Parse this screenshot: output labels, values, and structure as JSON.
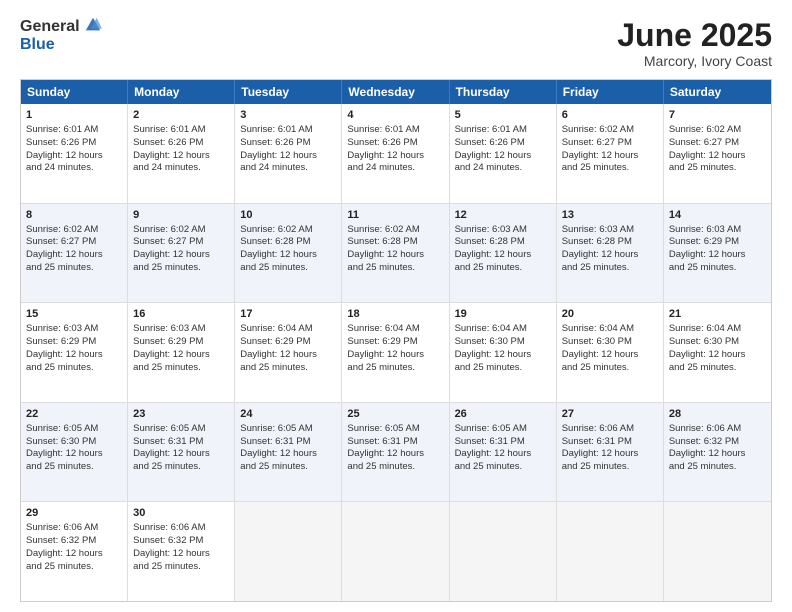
{
  "logo": {
    "general": "General",
    "blue": "Blue"
  },
  "title": "June 2025",
  "subtitle": "Marcory, Ivory Coast",
  "days": [
    "Sunday",
    "Monday",
    "Tuesday",
    "Wednesday",
    "Thursday",
    "Friday",
    "Saturday"
  ],
  "rows": [
    [
      {
        "num": "1",
        "lines": [
          "Sunrise: 6:01 AM",
          "Sunset: 6:26 PM",
          "Daylight: 12 hours",
          "and 24 minutes."
        ]
      },
      {
        "num": "2",
        "lines": [
          "Sunrise: 6:01 AM",
          "Sunset: 6:26 PM",
          "Daylight: 12 hours",
          "and 24 minutes."
        ]
      },
      {
        "num": "3",
        "lines": [
          "Sunrise: 6:01 AM",
          "Sunset: 6:26 PM",
          "Daylight: 12 hours",
          "and 24 minutes."
        ]
      },
      {
        "num": "4",
        "lines": [
          "Sunrise: 6:01 AM",
          "Sunset: 6:26 PM",
          "Daylight: 12 hours",
          "and 24 minutes."
        ]
      },
      {
        "num": "5",
        "lines": [
          "Sunrise: 6:01 AM",
          "Sunset: 6:26 PM",
          "Daylight: 12 hours",
          "and 24 minutes."
        ]
      },
      {
        "num": "6",
        "lines": [
          "Sunrise: 6:02 AM",
          "Sunset: 6:27 PM",
          "Daylight: 12 hours",
          "and 25 minutes."
        ]
      },
      {
        "num": "7",
        "lines": [
          "Sunrise: 6:02 AM",
          "Sunset: 6:27 PM",
          "Daylight: 12 hours",
          "and 25 minutes."
        ]
      }
    ],
    [
      {
        "num": "8",
        "lines": [
          "Sunrise: 6:02 AM",
          "Sunset: 6:27 PM",
          "Daylight: 12 hours",
          "and 25 minutes."
        ]
      },
      {
        "num": "9",
        "lines": [
          "Sunrise: 6:02 AM",
          "Sunset: 6:27 PM",
          "Daylight: 12 hours",
          "and 25 minutes."
        ]
      },
      {
        "num": "10",
        "lines": [
          "Sunrise: 6:02 AM",
          "Sunset: 6:28 PM",
          "Daylight: 12 hours",
          "and 25 minutes."
        ]
      },
      {
        "num": "11",
        "lines": [
          "Sunrise: 6:02 AM",
          "Sunset: 6:28 PM",
          "Daylight: 12 hours",
          "and 25 minutes."
        ]
      },
      {
        "num": "12",
        "lines": [
          "Sunrise: 6:03 AM",
          "Sunset: 6:28 PM",
          "Daylight: 12 hours",
          "and 25 minutes."
        ]
      },
      {
        "num": "13",
        "lines": [
          "Sunrise: 6:03 AM",
          "Sunset: 6:28 PM",
          "Daylight: 12 hours",
          "and 25 minutes."
        ]
      },
      {
        "num": "14",
        "lines": [
          "Sunrise: 6:03 AM",
          "Sunset: 6:29 PM",
          "Daylight: 12 hours",
          "and 25 minutes."
        ]
      }
    ],
    [
      {
        "num": "15",
        "lines": [
          "Sunrise: 6:03 AM",
          "Sunset: 6:29 PM",
          "Daylight: 12 hours",
          "and 25 minutes."
        ]
      },
      {
        "num": "16",
        "lines": [
          "Sunrise: 6:03 AM",
          "Sunset: 6:29 PM",
          "Daylight: 12 hours",
          "and 25 minutes."
        ]
      },
      {
        "num": "17",
        "lines": [
          "Sunrise: 6:04 AM",
          "Sunset: 6:29 PM",
          "Daylight: 12 hours",
          "and 25 minutes."
        ]
      },
      {
        "num": "18",
        "lines": [
          "Sunrise: 6:04 AM",
          "Sunset: 6:29 PM",
          "Daylight: 12 hours",
          "and 25 minutes."
        ]
      },
      {
        "num": "19",
        "lines": [
          "Sunrise: 6:04 AM",
          "Sunset: 6:30 PM",
          "Daylight: 12 hours",
          "and 25 minutes."
        ]
      },
      {
        "num": "20",
        "lines": [
          "Sunrise: 6:04 AM",
          "Sunset: 6:30 PM",
          "Daylight: 12 hours",
          "and 25 minutes."
        ]
      },
      {
        "num": "21",
        "lines": [
          "Sunrise: 6:04 AM",
          "Sunset: 6:30 PM",
          "Daylight: 12 hours",
          "and 25 minutes."
        ]
      }
    ],
    [
      {
        "num": "22",
        "lines": [
          "Sunrise: 6:05 AM",
          "Sunset: 6:30 PM",
          "Daylight: 12 hours",
          "and 25 minutes."
        ]
      },
      {
        "num": "23",
        "lines": [
          "Sunrise: 6:05 AM",
          "Sunset: 6:31 PM",
          "Daylight: 12 hours",
          "and 25 minutes."
        ]
      },
      {
        "num": "24",
        "lines": [
          "Sunrise: 6:05 AM",
          "Sunset: 6:31 PM",
          "Daylight: 12 hours",
          "and 25 minutes."
        ]
      },
      {
        "num": "25",
        "lines": [
          "Sunrise: 6:05 AM",
          "Sunset: 6:31 PM",
          "Daylight: 12 hours",
          "and 25 minutes."
        ]
      },
      {
        "num": "26",
        "lines": [
          "Sunrise: 6:05 AM",
          "Sunset: 6:31 PM",
          "Daylight: 12 hours",
          "and 25 minutes."
        ]
      },
      {
        "num": "27",
        "lines": [
          "Sunrise: 6:06 AM",
          "Sunset: 6:31 PM",
          "Daylight: 12 hours",
          "and 25 minutes."
        ]
      },
      {
        "num": "28",
        "lines": [
          "Sunrise: 6:06 AM",
          "Sunset: 6:32 PM",
          "Daylight: 12 hours",
          "and 25 minutes."
        ]
      }
    ],
    [
      {
        "num": "29",
        "lines": [
          "Sunrise: 6:06 AM",
          "Sunset: 6:32 PM",
          "Daylight: 12 hours",
          "and 25 minutes."
        ]
      },
      {
        "num": "30",
        "lines": [
          "Sunrise: 6:06 AM",
          "Sunset: 6:32 PM",
          "Daylight: 12 hours",
          "and 25 minutes."
        ]
      },
      {
        "num": "",
        "lines": []
      },
      {
        "num": "",
        "lines": []
      },
      {
        "num": "",
        "lines": []
      },
      {
        "num": "",
        "lines": []
      },
      {
        "num": "",
        "lines": []
      }
    ]
  ]
}
